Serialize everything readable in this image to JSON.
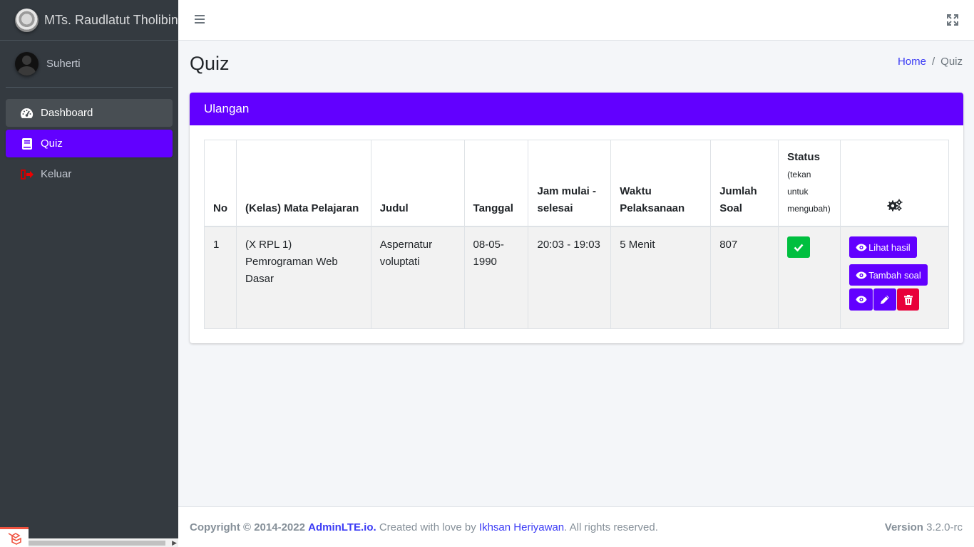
{
  "brand": {
    "name": "MTs. Raudlatut Tholibin"
  },
  "user": {
    "name": "Suherti"
  },
  "sidebar": {
    "items": [
      {
        "label": "Dashboard",
        "icon": "tachometer-icon"
      },
      {
        "label": "Quiz",
        "icon": "book-icon"
      },
      {
        "label": "Keluar",
        "icon": "sign-out-icon"
      }
    ]
  },
  "page": {
    "title": "Quiz",
    "breadcrumb": {
      "home": "Home",
      "current": "Quiz"
    }
  },
  "card": {
    "title": "Ulangan"
  },
  "table": {
    "headers": {
      "no": "No",
      "mapel": "(Kelas) Mata Pelajaran",
      "judul": "Judul",
      "tanggal": "Tanggal",
      "jam": "Jam mulai - selesai",
      "waktu": "Waktu Pelaksanaan",
      "jumlah": "Jumlah Soal",
      "status": "Status",
      "status_hint": "(tekan untuk mengubah)"
    },
    "rows": [
      {
        "no": "1",
        "mapel": "(X RPL 1) Pemrograman Web Dasar",
        "judul": "Aspernatur voluptati",
        "tanggal": "08-05-1990",
        "jam": "20:03 - 19:03",
        "waktu": "5 Menit",
        "jumlah": "807"
      }
    ],
    "actions": {
      "lihat_hasil": "Lihat hasil",
      "tambah_soal": "Tambah soal"
    }
  },
  "footer": {
    "copyright": "Copyright © 2014-2022",
    "adminlte": "AdminLTE.io.",
    "created": "Created with love by",
    "author": "Ikhsan Heriyawan",
    "rights": ". All rights reserved.",
    "version_label": "Version",
    "version": "3.2.0-rc"
  },
  "colors": {
    "primary": "#6200ff",
    "success": "#00bf3f",
    "danger": "#e8003a",
    "sidebar": "#343a40"
  }
}
